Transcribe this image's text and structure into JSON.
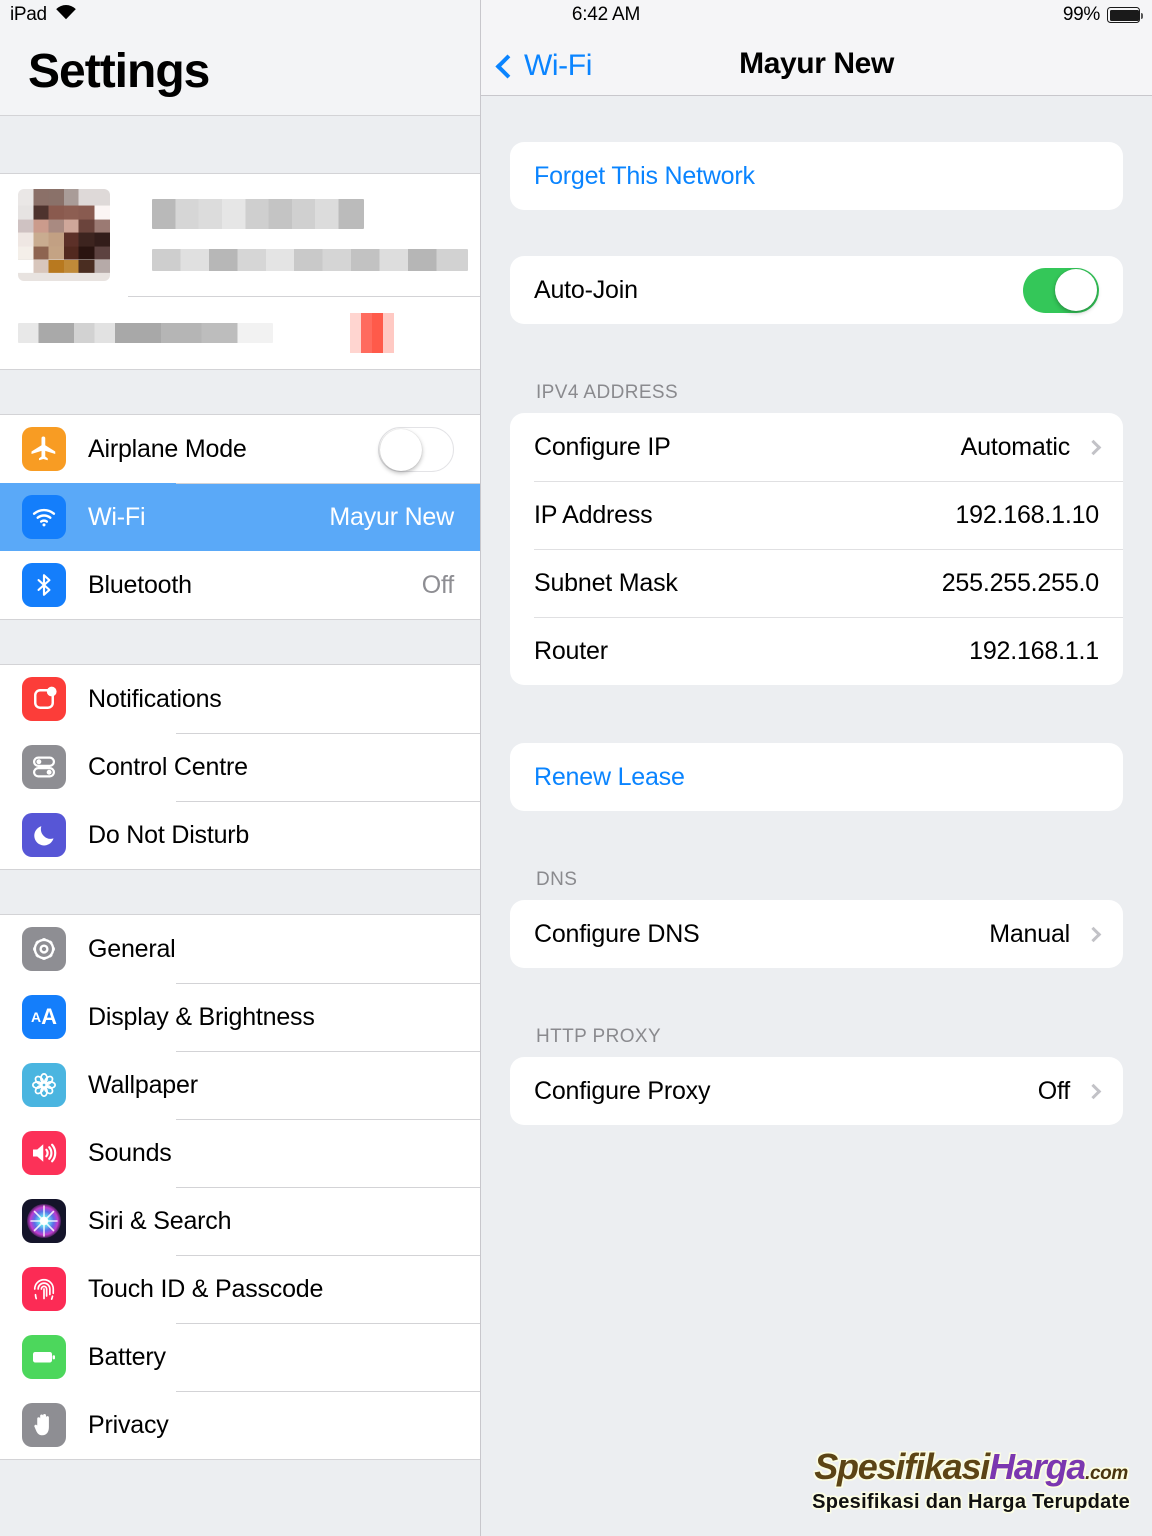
{
  "status_bar": {
    "device_label": "iPad",
    "wifi_icon": "wifi-icon",
    "time": "6:42 AM",
    "battery_percent": "99%",
    "battery_level": 99
  },
  "sidebar": {
    "title": "Settings",
    "account": {
      "name_redacted": true,
      "subtitle_redacted": true,
      "second_row_redacted": true,
      "badge_color": "#ff5a4a"
    },
    "groups": [
      {
        "items": [
          {
            "label": "Airplane Mode",
            "icon": "airplane-icon",
            "icon_color": "#f89c23",
            "control": "toggle",
            "toggle_on": false
          },
          {
            "label": "Wi-Fi",
            "icon": "wifi-icon",
            "icon_color": "#147efb",
            "value": "Mayur New",
            "selected": true
          },
          {
            "label": "Bluetooth",
            "icon": "bluetooth-icon",
            "icon_color": "#147efb",
            "value": "Off"
          }
        ]
      },
      {
        "items": [
          {
            "label": "Notifications",
            "icon": "notifications-icon",
            "icon_color": "#fc3d39"
          },
          {
            "label": "Control Centre",
            "icon": "control-centre-icon",
            "icon_color": "#8e8e93"
          },
          {
            "label": "Do Not Disturb",
            "icon": "do-not-disturb-icon",
            "icon_color": "#5756d6"
          }
        ]
      },
      {
        "items": [
          {
            "label": "General",
            "icon": "gear-icon",
            "icon_color": "#8e8e93"
          },
          {
            "label": "Display & Brightness",
            "icon": "display-brightness-icon",
            "icon_color": "#147efb"
          },
          {
            "label": "Wallpaper",
            "icon": "wallpaper-icon",
            "icon_color": "#4ab5e0"
          },
          {
            "label": "Sounds",
            "icon": "sounds-icon",
            "icon_color": "#fc3158"
          },
          {
            "label": "Siri & Search",
            "icon": "siri-icon",
            "icon_color": "#1c1c30"
          },
          {
            "label": "Touch ID & Passcode",
            "icon": "touch-id-icon",
            "icon_color": "#fc2b55"
          },
          {
            "label": "Battery",
            "icon": "battery-icon",
            "icon_color": "#4cd75c"
          },
          {
            "label": "Privacy",
            "icon": "privacy-hand-icon",
            "icon_color": "#8e8e93"
          }
        ]
      }
    ]
  },
  "detail": {
    "back_label": "Wi-Fi",
    "title": "Mayur New",
    "forget_network_label": "Forget This Network",
    "auto_join": {
      "label": "Auto-Join",
      "enabled": true
    },
    "ipv4": {
      "header": "IPV4 ADDRESS",
      "rows": [
        {
          "label": "Configure IP",
          "value": "Automatic",
          "chevron": true
        },
        {
          "label": "IP Address",
          "value": "192.168.1.10",
          "chevron": false
        },
        {
          "label": "Subnet Mask",
          "value": "255.255.255.0",
          "chevron": false
        },
        {
          "label": "Router",
          "value": "192.168.1.1",
          "chevron": false
        }
      ]
    },
    "renew_lease_label": "Renew Lease",
    "dns": {
      "header": "DNS",
      "rows": [
        {
          "label": "Configure DNS",
          "value": "Manual",
          "chevron": true
        }
      ]
    },
    "http_proxy": {
      "header": "HTTP PROXY",
      "rows": [
        {
          "label": "Configure Proxy",
          "value": "Off",
          "chevron": true
        }
      ]
    }
  },
  "watermark": {
    "brand_part1": "Spesifikasi",
    "brand_part2": "Harga",
    "brand_tld": ".com",
    "tagline": "Spesifikasi dan Harga Terupdate"
  },
  "colors": {
    "accent_blue": "#0a84ff",
    "selection_blue": "#5aa9f8",
    "toggle_green": "#34c759",
    "background": "#eceef1"
  }
}
